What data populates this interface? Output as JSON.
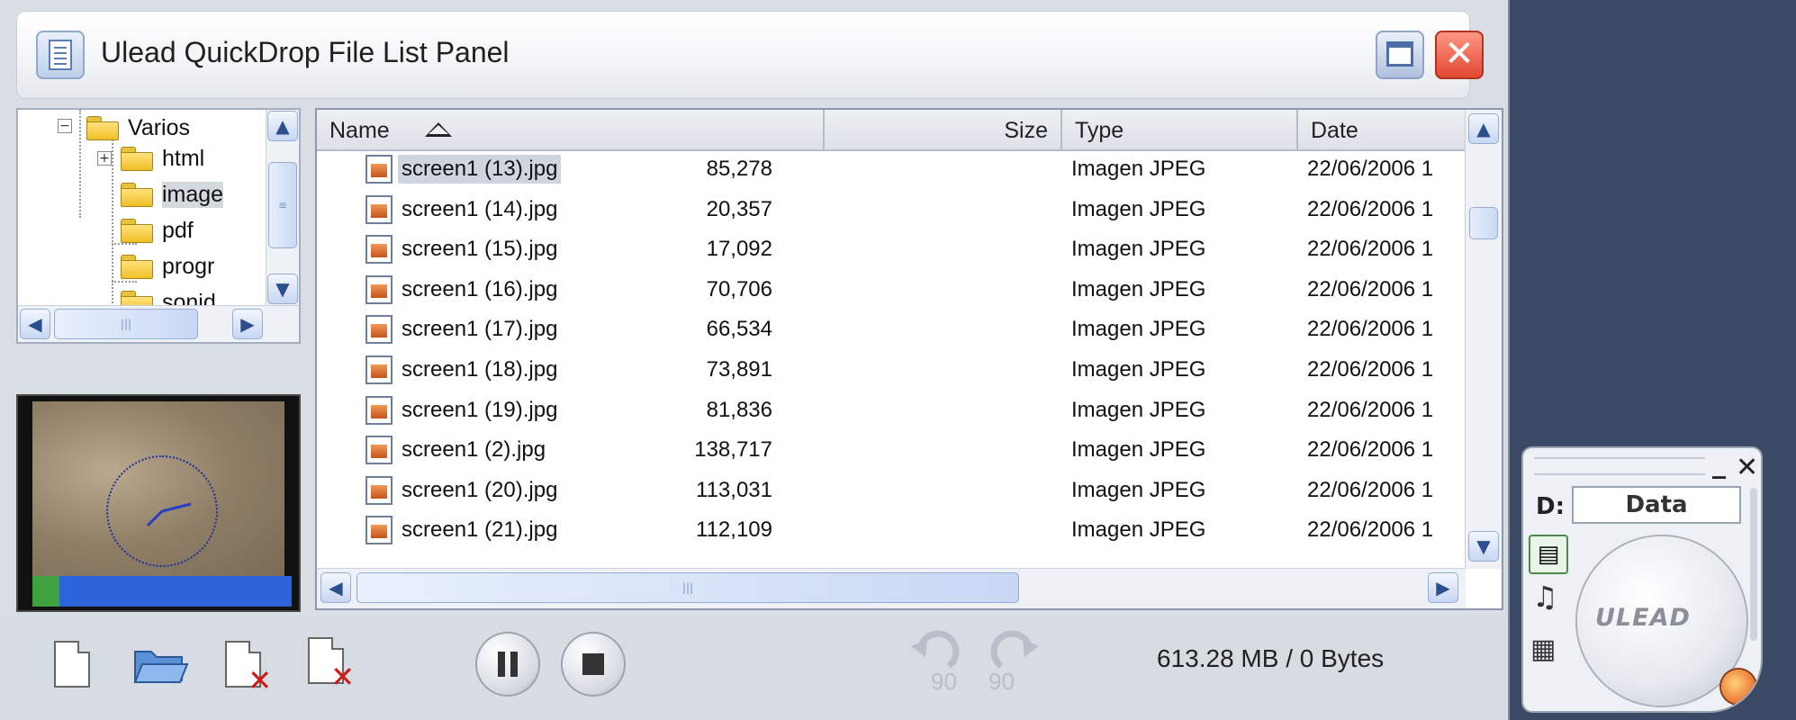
{
  "window": {
    "title": "Ulead QuickDrop File List Panel"
  },
  "tree": {
    "items": [
      {
        "label": "Varios"
      },
      {
        "label": "html"
      },
      {
        "label": "image"
      },
      {
        "label": "pdf"
      },
      {
        "label": "progr"
      },
      {
        "label": "sonid"
      }
    ]
  },
  "list": {
    "columns": {
      "name": "Name",
      "size": "Size",
      "type": "Type",
      "date": "Date"
    },
    "rows": [
      {
        "name": "screen1 (13).jpg",
        "size": "85,278",
        "type": "Imagen JPEG",
        "date": "22/06/2006 1"
      },
      {
        "name": "screen1 (14).jpg",
        "size": "20,357",
        "type": "Imagen JPEG",
        "date": "22/06/2006 1"
      },
      {
        "name": "screen1 (15).jpg",
        "size": "17,092",
        "type": "Imagen JPEG",
        "date": "22/06/2006 1"
      },
      {
        "name": "screen1 (16).jpg",
        "size": "70,706",
        "type": "Imagen JPEG",
        "date": "22/06/2006 1"
      },
      {
        "name": "screen1 (17).jpg",
        "size": "66,534",
        "type": "Imagen JPEG",
        "date": "22/06/2006 1"
      },
      {
        "name": "screen1 (18).jpg",
        "size": "73,891",
        "type": "Imagen JPEG",
        "date": "22/06/2006 1"
      },
      {
        "name": "screen1 (19).jpg",
        "size": "81,836",
        "type": "Imagen JPEG",
        "date": "22/06/2006 1"
      },
      {
        "name": "screen1 (2).jpg",
        "size": "138,717",
        "type": "Imagen JPEG",
        "date": "22/06/2006 1"
      },
      {
        "name": "screen1 (20).jpg",
        "size": "113,031",
        "type": "Imagen JPEG",
        "date": "22/06/2006 1"
      },
      {
        "name": "screen1 (21).jpg",
        "size": "112,109",
        "type": "Imagen JPEG",
        "date": "22/06/2006 1"
      }
    ]
  },
  "toolbar": {
    "rotate_left_label": "90",
    "rotate_right_label": "90",
    "status": "613.28 MB / 0 Bytes"
  },
  "quickdrop": {
    "drive_letter": "D:",
    "drive_label": "Data",
    "logo_text": "ULEAD"
  }
}
